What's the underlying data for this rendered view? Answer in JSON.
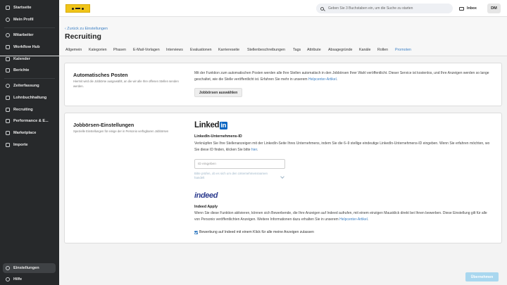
{
  "sidebar": {
    "items": [
      {
        "label": "Startseite",
        "icon": "home-icon"
      },
      {
        "label": "Mein Profil",
        "icon": "user-icon"
      },
      {
        "label": "Mitarbeiter",
        "icon": "users-icon"
      },
      {
        "label": "Workflow Hub",
        "icon": "workflow-icon"
      },
      {
        "label": "Kalender",
        "icon": "calendar-icon"
      },
      {
        "label": "Berichte",
        "icon": "reports-icon"
      },
      {
        "label": "Zeiterfassung",
        "icon": "clock-icon"
      },
      {
        "label": "Lohnbuchhaltung",
        "icon": "payroll-icon"
      },
      {
        "label": "Recruiting",
        "icon": "recruiting-icon"
      },
      {
        "label": "Performance & E...",
        "icon": "performance-icon"
      },
      {
        "label": "Marketplace",
        "icon": "marketplace-icon"
      },
      {
        "label": "Importe",
        "icon": "import-icon"
      }
    ],
    "bottom": [
      {
        "label": "Einstellungen",
        "icon": "gear-icon"
      },
      {
        "label": "Hilfe",
        "icon": "help-icon"
      }
    ]
  },
  "topbar": {
    "search_placeholder": "Geben Sie 3 Buchstaben ein, um die Suche zu starten",
    "inbox_label": "Inbox",
    "avatar_initials": "DM"
  },
  "header": {
    "back_link": "‹ Zurück zu Einstellungen",
    "title": "Recruiting",
    "tabs": [
      "Allgemein",
      "Kategorien",
      "Phasen",
      "E-Mail-Vorlagen",
      "Interviews",
      "Evaluationen",
      "Karriereseite",
      "Stellenbeschreibungen",
      "Tags",
      "Attribute",
      "Absagegründe",
      "Kanäle",
      "Rollen",
      "Promoten"
    ],
    "active_tab": "Promoten"
  },
  "auto_post": {
    "title": "Automatisches Posten",
    "subtitle": "Hiermit wird die Jobbörse ausgewählt, an die wir alle Ihre offenen Stellen senden werden.",
    "text_before_link": "Mit der Funktion zum automatischen Posten werden alle Ihre Stellen automatisch in den Jobbörsen Ihrer Wahl veröffentlicht. Dieser Service ist kostenlos, und Ihre Anzeigen werden so lange geschaltet, wie die Stelle veröffentlicht ist. Erfahren Sie mehr in unserem ",
    "link": "Helpcenter-Artikel",
    "text_after_link": ".",
    "button": "Jobbörsen auswählen"
  },
  "jobboard": {
    "title": "Jobbörsen-Einstellungen",
    "subtitle": "Spezielle Einstellungen für einige der in Personio verfügbaren Jobbörsen",
    "linkedin": {
      "logo_text": "Linked",
      "logo_in": "in",
      "label": "LinkedIn-Unternehmens-ID",
      "text_before_link": "Verknüpfen Sie Ihre Stellenanzeigen mit der LinkedIn-Seite Ihres Unternehmens, indem Sie die 6–9 stellige eindeutige LinkedIn-Unternehmens-ID eingeben. Wenn Sie erfahren möchten, wo Sie diese ID finden, klicken Sie bitte ",
      "link": "hier",
      "text_after_link": ".",
      "input_placeholder": "ID eingeben",
      "hint": "Bitte prüfen, ob es sich um den Unternehmensnamen handelt"
    },
    "indeed": {
      "logo_text": "indeed",
      "label": "Indeed Apply",
      "text_before_link": "Wenn Sie diese Funktion aktivieren, können sich Bewerbende, die Ihre Anzeigen auf Indeed aufrufen, mit einem einzigen Mausklick direkt bei Ihnen bewerben. Diese Einstellung gilt für alle von Personio veröffentlichten Anzeigen. Weitere Informationen dazu erhalten Sie in unserem ",
      "link": "Helpcenter-Artikel",
      "text_after_link": ".",
      "checkbox_label": "Bewerbung auf Indeed mit einem Klick für alle meine Anzeigen zulassen",
      "checkbox_checked": true
    }
  },
  "footer": {
    "save_button": "Übernehmen"
  },
  "colors": {
    "accent": "#3b7fc4",
    "sidebar": "#27292b",
    "linkedin": "#0a66c2",
    "indeed": "#2d3c8e",
    "logo": "#f0c419"
  }
}
